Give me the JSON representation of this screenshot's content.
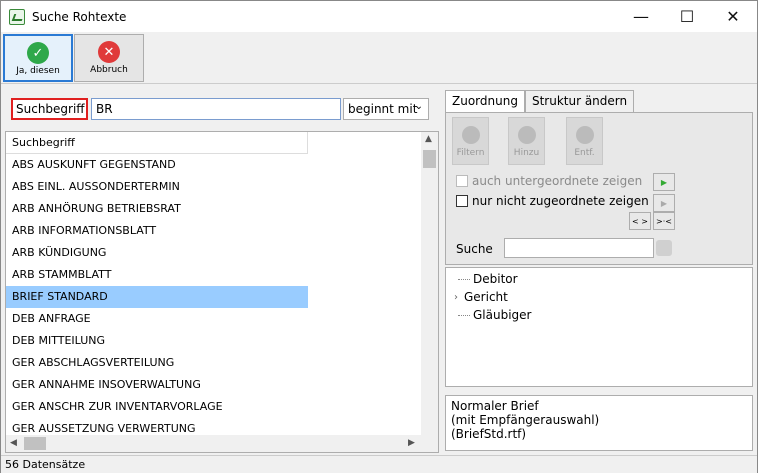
{
  "window": {
    "title": "Suche Rohtexte",
    "minimize_glyph": "—",
    "maximize_glyph": "☐",
    "close_glyph": "✕"
  },
  "toolbar": {
    "yes_label": "Ja, diesen",
    "cancel_label": "Abbruch",
    "yes_color": "#2ea84a",
    "cancel_color": "#e03a3a"
  },
  "search": {
    "label": "Suchbegriff",
    "value": "BR",
    "mode": "beginnt mit"
  },
  "list": {
    "column": "Suchbegriff",
    "rows": [
      "ABS AUSKUNFT GEGENSTAND",
      "ABS EINL. AUSSONDERTERMIN",
      "ARB ANHÖRUNG BETRIEBSRAT",
      "ARB INFORMATIONSBLATT",
      "ARB KÜNDIGUNG",
      "ARB STAMMBLATT",
      "BRIEF STANDARD",
      "DEB ANFRAGE",
      "DEB MITTEILUNG",
      "GER ABSCHLAGSVERTEILUNG",
      "GER ANNAHME INSOVERWALTUNG",
      "GER ANSCHR ZUR INVENTARVORLAGE",
      "GER AUSSETZUNG VERWERTUNG"
    ],
    "selected_index": 6
  },
  "tabs": [
    "Zuordnung",
    "Struktur ändern"
  ],
  "assign": {
    "buttons": [
      "Filtern",
      "Hinzu",
      "Entf."
    ],
    "chk_sub": "auch untergeordnete zeigen",
    "chk_unassigned": "nur nicht zugeordnete zeigen",
    "btn_expand": "< >",
    "btn_collapse": ">·<",
    "search_label": "Suche",
    "search_value": ""
  },
  "tree": [
    "Debitor",
    "Gericht",
    "Gläubiger"
  ],
  "description": {
    "line1": "Normaler Brief",
    "line2": "(mit Empfängerauswahl)",
    "line3": "(BriefStd.rtf)"
  },
  "status": {
    "count": "56 Datensätze"
  }
}
